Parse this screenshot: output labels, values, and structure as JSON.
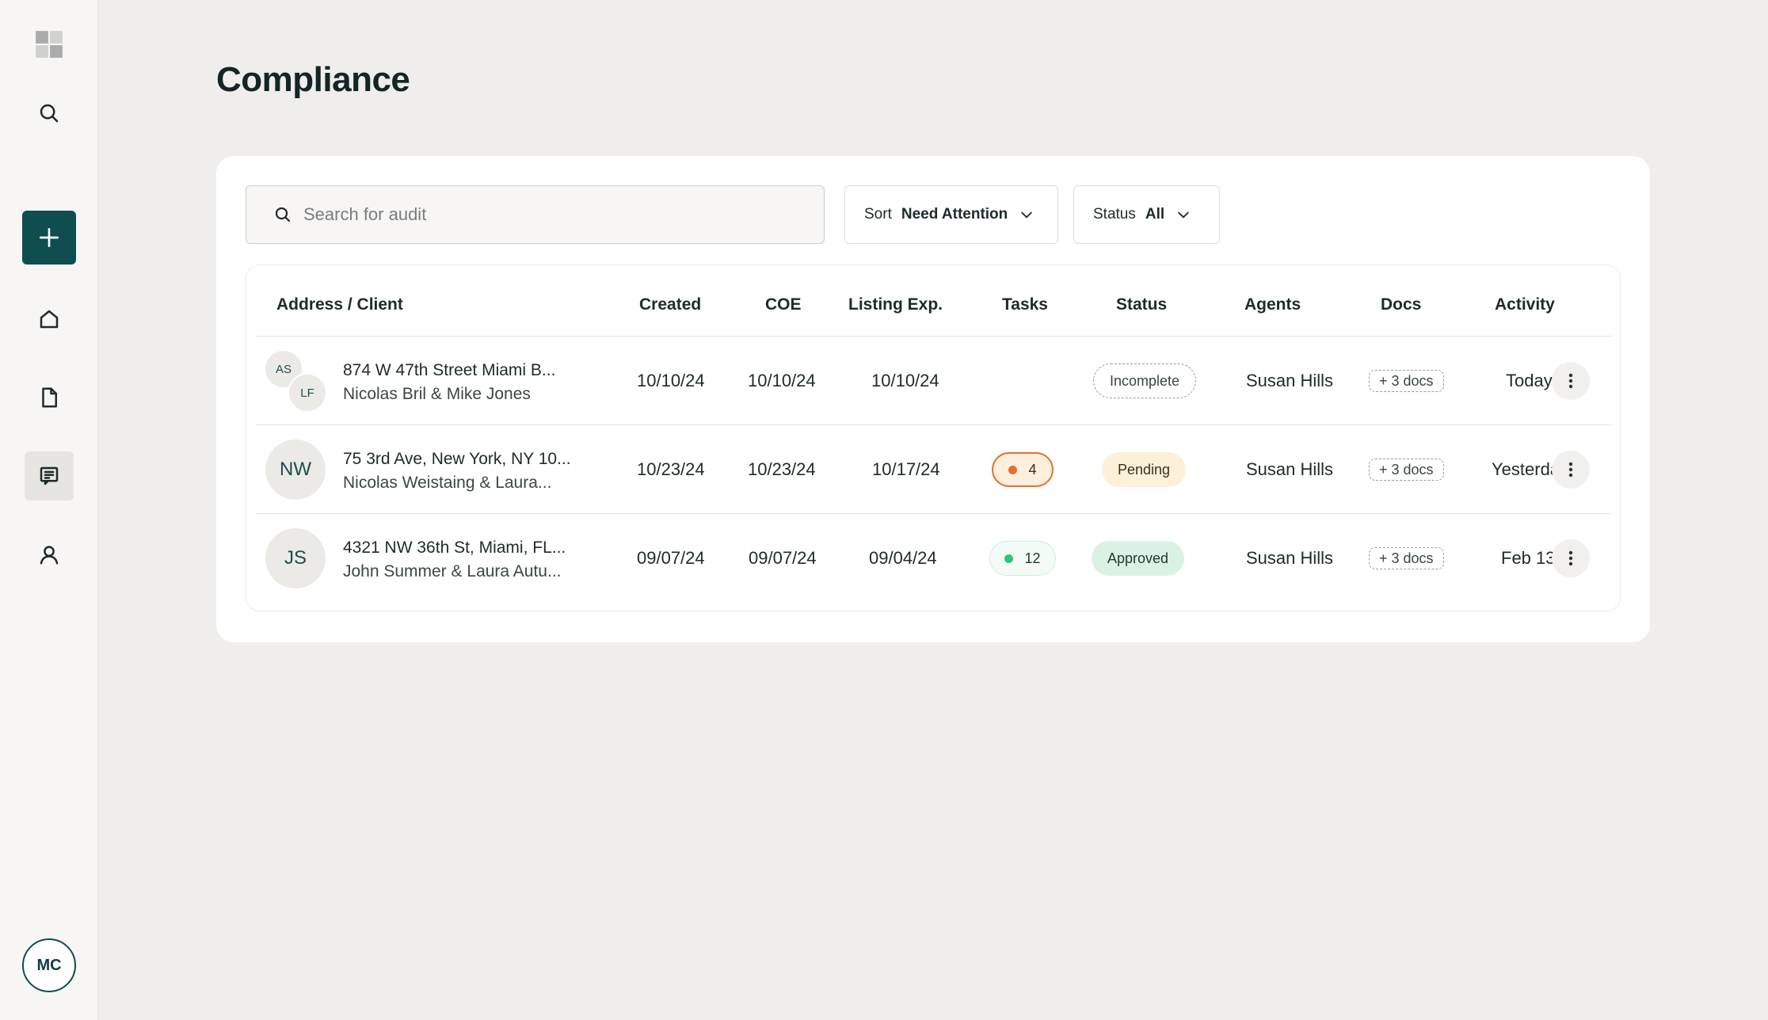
{
  "sidebar": {
    "avatar_initials": "MC",
    "items": [
      {
        "name": "logo",
        "icon": "grid-logo-icon"
      },
      {
        "name": "search",
        "icon": "search-icon"
      },
      {
        "name": "add",
        "icon": "plus-icon"
      },
      {
        "name": "home",
        "icon": "home-icon"
      },
      {
        "name": "documents",
        "icon": "document-icon"
      },
      {
        "name": "compliance",
        "icon": "compliance-checklist-icon",
        "active": true
      },
      {
        "name": "profile",
        "icon": "user-icon"
      }
    ]
  },
  "page": {
    "title": "Compliance"
  },
  "toolbar": {
    "search_placeholder": "Search for audit",
    "sort_label": "Sort",
    "sort_value": "Need Attention",
    "status_label": "Status",
    "status_value": "All"
  },
  "table": {
    "columns": [
      "Address / Client",
      "Created",
      "COE",
      "Listing Exp.",
      "Tasks",
      "Status",
      "Agents",
      "Docs",
      "Activity"
    ],
    "rows": [
      {
        "avatars": [
          "AS",
          "LF"
        ],
        "address": "874 W 47th Street Miami B...",
        "client": "Nicolas Bril & Mike Jones",
        "created": "10/10/24",
        "coe": "10/10/24",
        "listing_exp": "10/10/24",
        "tasks": "",
        "status": "Incomplete",
        "agent": "Susan Hills",
        "docs": "+ 3 docs",
        "activity": "Today"
      },
      {
        "avatars": [
          "NW"
        ],
        "address": "75 3rd Ave, New York, NY 10...",
        "client": "Nicolas Weistaing & Laura...",
        "created": "10/23/24",
        "coe": "10/23/24",
        "listing_exp": "10/17/24",
        "tasks": "4",
        "status": "Pending",
        "agent": "Susan Hills",
        "docs": "+ 3 docs",
        "activity": "Yesterday"
      },
      {
        "avatars": [
          "JS"
        ],
        "address": "4321 NW 36th St, Miami, FL...",
        "client": "John Summer & Laura Autu...",
        "created": "09/07/24",
        "coe": "09/07/24",
        "listing_exp": "09/04/24",
        "tasks": "12",
        "status": "Approved",
        "agent": "Susan Hills",
        "docs": "+ 3 docs",
        "activity": "Feb 13th"
      }
    ]
  },
  "colors": {
    "accent": "#0f4d4f",
    "pending_bg": "#fdf0d9",
    "approved_bg": "#daf2e4",
    "task_warning": "#e4712f",
    "task_ok": "#2ec77a"
  }
}
